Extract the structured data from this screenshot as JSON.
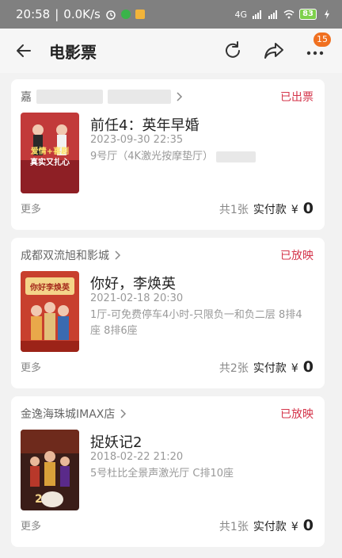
{
  "status_bar": {
    "time": "20:58",
    "speed": "0.0K/s",
    "network": "4G",
    "battery": "83"
  },
  "header": {
    "title": "电影票",
    "badge": "15"
  },
  "orders": [
    {
      "cinema": "嘉",
      "status": "已出票",
      "title": "前任4：英年早婚",
      "datetime": "2023-09-30 22:35",
      "hall": "9号厅（4K激光按摩垫厅）",
      "more": "更多",
      "count": "共1张",
      "paid_label": "实付款",
      "currency": "¥",
      "amount": "0",
      "poster_text": "爱情+喜剧 真实又扎心",
      "poster_color": "#c23a3a"
    },
    {
      "cinema": "成都双流旭和影城",
      "status": "已放映",
      "title": "你好，李焕英",
      "datetime": "2021-02-18 20:30",
      "hall": "1厅-可免费停车4小时-只限负一和负二层 8排4座 8排6座",
      "more": "更多",
      "count": "共2张",
      "paid_label": "实付款",
      "currency": "¥",
      "amount": "0",
      "poster_text": "你好，李焕英",
      "poster_color": "#d9a13a"
    },
    {
      "cinema": "金逸海珠城IMAX店",
      "status": "已放映",
      "title": "捉妖记2",
      "datetime": "2018-02-22 21:20",
      "hall": "5号杜比全景声激光厅 C排10座",
      "more": "更多",
      "count": "共1张",
      "paid_label": "实付款",
      "currency": "¥",
      "amount": "0",
      "poster_text": "捉妖记2",
      "poster_color": "#8a2a1f"
    }
  ],
  "colors": {
    "accent_red": "#d4344a",
    "badge_orange": "#f07020"
  }
}
